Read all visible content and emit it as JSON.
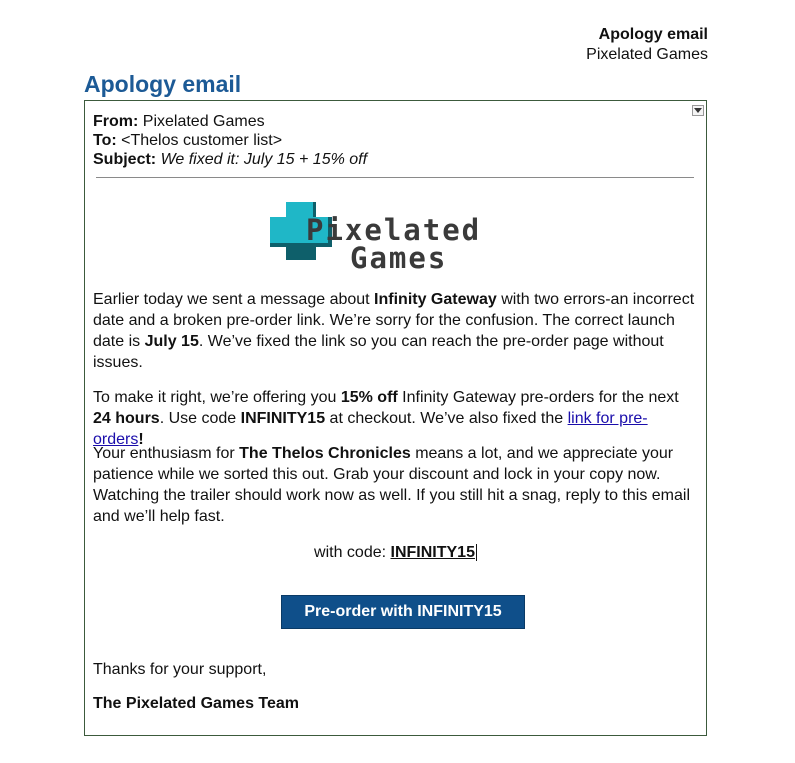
{
  "header": {
    "title": "Apology email",
    "subtitle": "Pixelated Games"
  },
  "page_title": "Apology email",
  "email": {
    "from_label": "From:",
    "from_value": "Pixelated Games",
    "to_label": "To:",
    "to_value": "<Thelos customer list>",
    "subject_label": "Subject:",
    "subject_value": "We fixed it: July 15 + 15% off",
    "logo": {
      "line1": "Pixelated",
      "line2": "Games",
      "icon": "pixel-plus-icon",
      "colors": {
        "cyan": "#1fb7c7",
        "dark_teal": "#0e5f6a",
        "text": "#3a3a3a"
      }
    },
    "p1": {
      "t1": "Earlier today we sent a message about ",
      "b1": "Infinity Gateway",
      "t2": " with two errors-an incorrect date and a broken pre-order link. We’re sorry for the confusion. The correct launch date is ",
      "b2": "July 15",
      "t3": ". We’ve fixed the link so you can reach the pre-order page without issues."
    },
    "p2": {
      "t1": "To make it right, we’re offering you ",
      "b1": "15% off",
      "t2": " Infinity Gateway pre-orders for the next ",
      "b2": "24 hours",
      "t3": ". Use code ",
      "b3": "INFINITY15",
      "t4": " at checkout. We’ve also fixed the ",
      "link": "link for pre-orders",
      "b4": "!"
    },
    "p3": {
      "t1": "Your enthusiasm for ",
      "b1": "The Thelos Chronicles",
      "t2": " means a lot, and we appreciate your patience while we sorted this out. Grab your discount and lock in your copy now. Watching the trailer should work now as well. If you still hit a snag, reply to this email and we’ll help fast."
    },
    "code_prefix": "with code: ",
    "code_value": "INFINITY15",
    "cta_label": "Pre-order with INFINITY15",
    "thanks": "Thanks for your support,",
    "signoff": "The Pixelated Games Team"
  },
  "colors": {
    "title_blue": "#1c5a96",
    "cta_bg": "#0f4f8a",
    "border_green": "#3c5a3c",
    "link_blue": "#1a0dab"
  }
}
